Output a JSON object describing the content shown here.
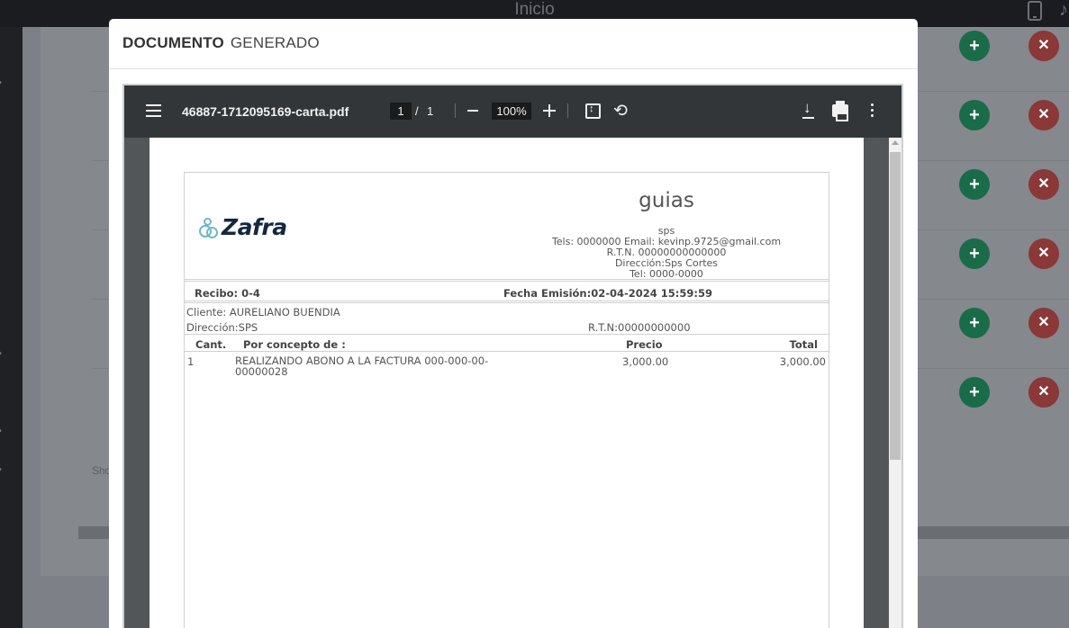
{
  "app": {
    "title": "Inicio"
  },
  "background": {
    "show_text": "Sho"
  },
  "modal": {
    "title_bold": "DOCUMENTO",
    "title_rest": "GENERADO"
  },
  "viewer": {
    "filename": "46887-1712095169-carta.pdf",
    "current_page": "1",
    "page_separator": "/",
    "total_pages": "1",
    "zoom": "100%"
  },
  "document": {
    "logo_text": "Zafra",
    "company_name": "guias",
    "company_city": "sps",
    "company_contact": "Tels: 0000000 Email: kevinp.9725@gmail.com",
    "company_rtn": "R.T.N. 00000000000000",
    "company_address": "Dirección:Sps Cortes",
    "company_tel": "Tel: 0000-0000",
    "recibo": "Recibo: 0-4",
    "fecha": "Fecha Emisión:02-04-2024 15:59:59",
    "cliente": "Cliente: AURELIANO BUENDIA",
    "direccion": "Dirección:SPS",
    "rtn": "R.T.N:00000000000",
    "table": {
      "headers": {
        "cant": "Cant.",
        "concepto": "Por concepto de :",
        "precio": "Precio",
        "total": "Total"
      },
      "rows": [
        {
          "cant": "1",
          "concepto": "REALIZANDO ABONO A LA FACTURA 000-000-00-00000028",
          "precio": "3,000.00",
          "total": "3,000.00"
        }
      ]
    }
  },
  "colors": {
    "add_button": "#1a6b4a",
    "delete_button": "#8a3838",
    "toolbar": "#323639",
    "viewer_bg": "#525659"
  }
}
